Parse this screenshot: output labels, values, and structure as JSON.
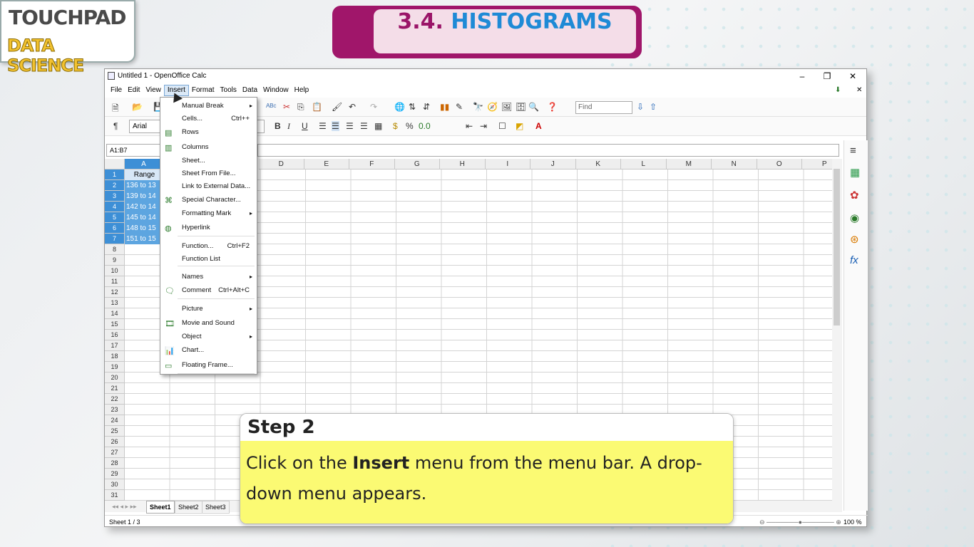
{
  "logo": {
    "line1": "TOUCHPAD",
    "line2": "DATA SCIENCE"
  },
  "topic": {
    "number": "3.4.",
    "title": "HISTOGRAMS"
  },
  "window": {
    "title": "Untitled 1 - OpenOffice Calc",
    "minimize": "–",
    "maximize": "❐",
    "close": "✕"
  },
  "menubar": [
    "File",
    "Edit",
    "View",
    "Insert",
    "Format",
    "Tools",
    "Data",
    "Window",
    "Help"
  ],
  "toolbar": {
    "font_name": "Arial",
    "find_placeholder": "Find",
    "bold": "B",
    "italic": "I",
    "underline": "U"
  },
  "namebox": "A1:B7",
  "columns": [
    "A",
    "D",
    "E",
    "F",
    "G",
    "H",
    "I",
    "J",
    "K",
    "L",
    "M",
    "N",
    "O",
    "P"
  ],
  "rows": [
    "1",
    "2",
    "3",
    "4",
    "5",
    "6",
    "7",
    "8",
    "9",
    "10",
    "11",
    "12",
    "13",
    "14",
    "15",
    "16",
    "17",
    "18",
    "19",
    "20",
    "21",
    "22",
    "23",
    "24",
    "25",
    "26",
    "27",
    "28",
    "29",
    "30",
    "31"
  ],
  "cells": [
    "Range",
    "136 to 13",
    "139 to 14",
    "142 to 14",
    "145 to 14",
    "148 to 15",
    "151 to 15"
  ],
  "insert_menu": [
    {
      "label": "Manual Break",
      "shortcut": "",
      "submenu": true,
      "icon": ""
    },
    {
      "label": "Cells...",
      "shortcut": "Ctrl++",
      "submenu": false,
      "icon": ""
    },
    {
      "label": "Rows",
      "shortcut": "",
      "submenu": false,
      "icon": "rows-icon"
    },
    {
      "label": "Columns",
      "shortcut": "",
      "submenu": false,
      "icon": "columns-icon"
    },
    {
      "label": "Sheet...",
      "shortcut": "",
      "submenu": false,
      "icon": ""
    },
    {
      "label": "Sheet From File...",
      "shortcut": "",
      "submenu": false,
      "icon": ""
    },
    {
      "label": "Link to External Data...",
      "shortcut": "",
      "submenu": false,
      "icon": ""
    },
    {
      "label": "Special Character...",
      "shortcut": "",
      "submenu": false,
      "icon": "special-character-icon"
    },
    {
      "label": "Formatting Mark",
      "shortcut": "",
      "submenu": true,
      "icon": ""
    },
    {
      "label": "Hyperlink",
      "shortcut": "",
      "submenu": false,
      "icon": "hyperlink-icon"
    },
    {
      "label": "Function...",
      "shortcut": "Ctrl+F2",
      "submenu": false,
      "icon": ""
    },
    {
      "label": "Function List",
      "shortcut": "",
      "submenu": false,
      "icon": ""
    },
    {
      "label": "Names",
      "shortcut": "",
      "submenu": true,
      "icon": ""
    },
    {
      "label": "Comment",
      "shortcut": "Ctrl+Alt+C",
      "submenu": false,
      "icon": "comment-icon"
    },
    {
      "label": "Picture",
      "shortcut": "",
      "submenu": true,
      "icon": ""
    },
    {
      "label": "Movie and Sound",
      "shortcut": "",
      "submenu": false,
      "icon": "movie-icon"
    },
    {
      "label": "Object",
      "shortcut": "",
      "submenu": true,
      "icon": ""
    },
    {
      "label": "Chart...",
      "shortcut": "",
      "submenu": false,
      "icon": "chart-icon"
    },
    {
      "label": "Floating Frame...",
      "shortcut": "",
      "submenu": false,
      "icon": "frame-icon"
    }
  ],
  "sheet_tabs": [
    "Sheet1",
    "Sheet2",
    "Sheet3"
  ],
  "status": {
    "sheet": "Sheet 1 / 3",
    "zoom": "100 %"
  },
  "callout": {
    "step": "Step 2",
    "text_before": "Click on the ",
    "bold": "Insert",
    "text_after": " menu from the menu bar. A drop-down menu appears."
  }
}
